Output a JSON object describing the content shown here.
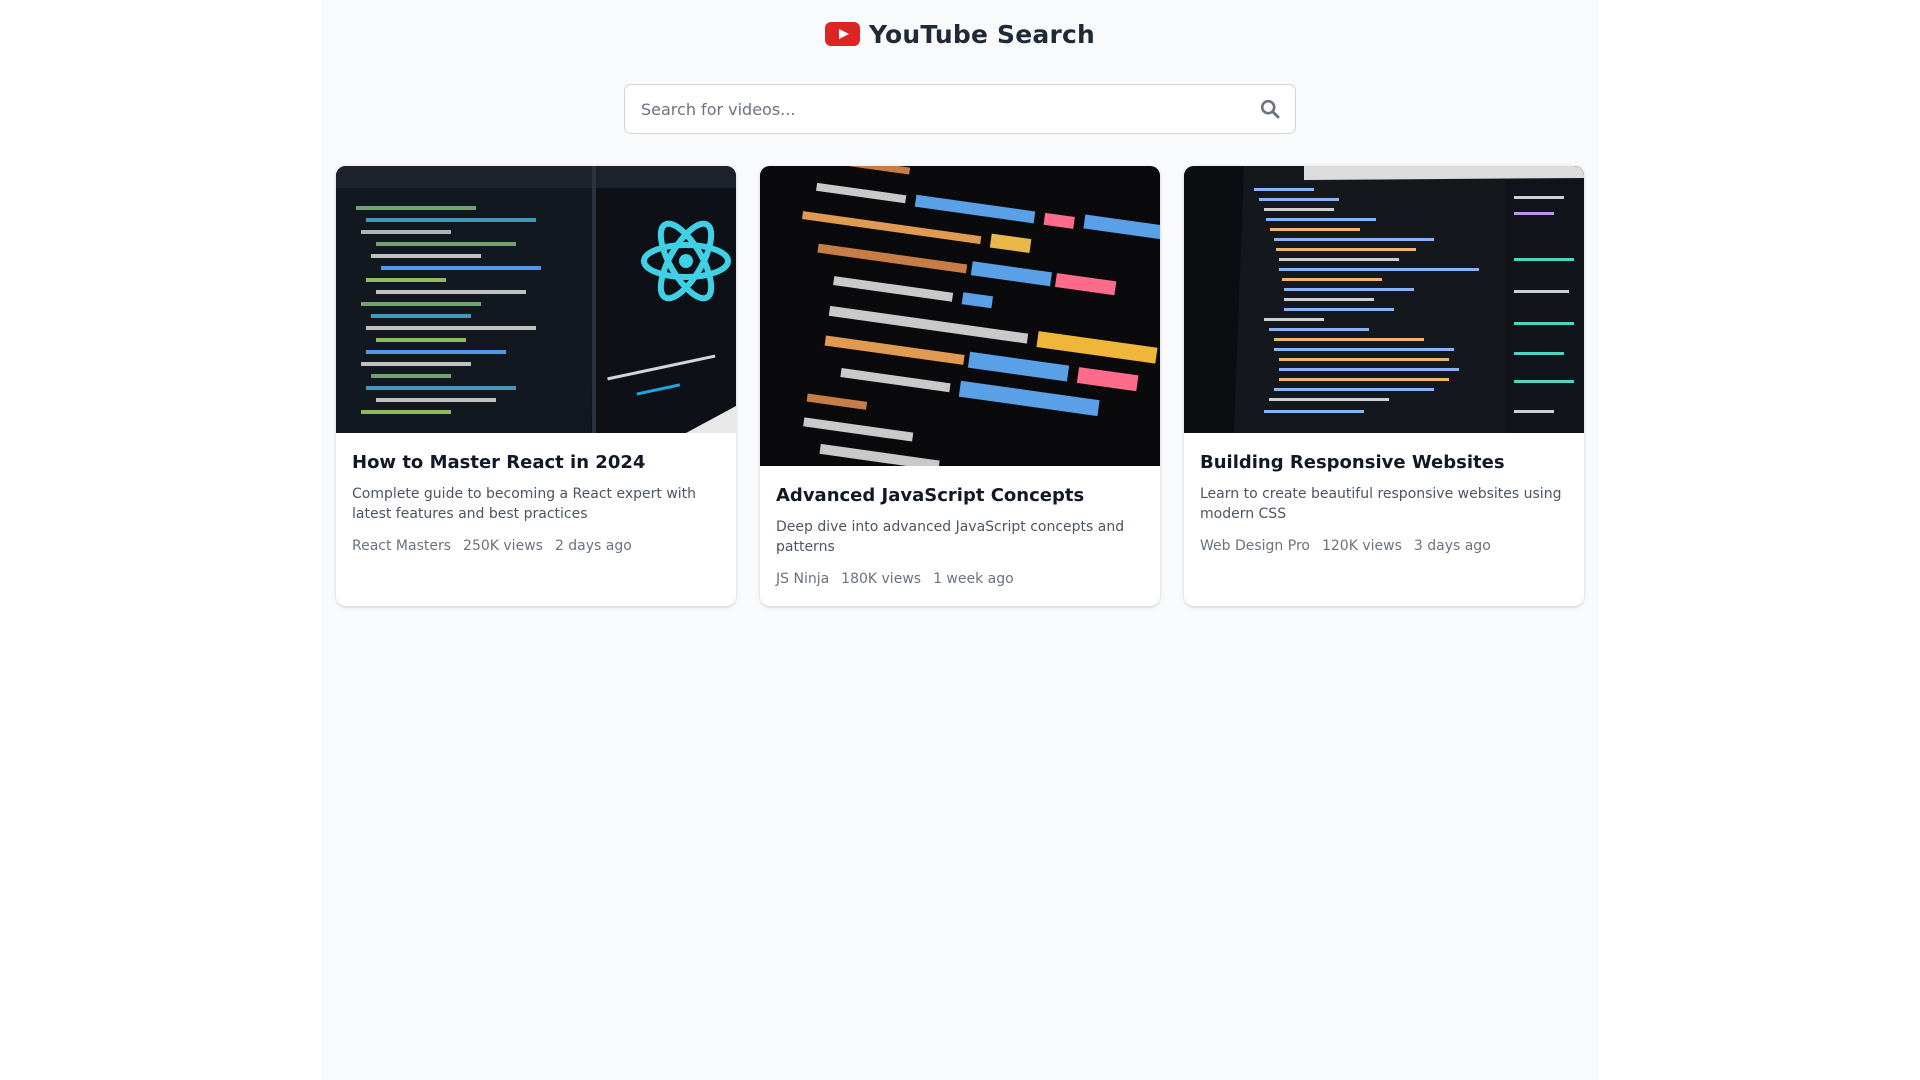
{
  "header": {
    "title": "YouTube Search",
    "logo_icon": "youtube-play-icon",
    "brand_color": "#dc2626"
  },
  "search": {
    "placeholder": "Search for videos...",
    "value": "",
    "button_icon": "search-icon"
  },
  "videos": [
    {
      "title": "How to Master React in 2024",
      "description": "Complete guide to becoming a React expert with latest features and best practices",
      "channel": "React Masters",
      "views": "250K views",
      "uploaded": "2 days ago",
      "thumbnail_icon": "react-code-thumbnail"
    },
    {
      "title": "Advanced JavaScript Concepts",
      "description": "Deep dive into advanced JavaScript concepts and patterns",
      "channel": "JS Ninja",
      "views": "180K views",
      "uploaded": "1 week ago",
      "thumbnail_icon": "javascript-code-thumbnail"
    },
    {
      "title": "Building Responsive Websites",
      "description": "Learn to create beautiful responsive websites using modern CSS",
      "channel": "Web Design Pro",
      "views": "120K views",
      "uploaded": "3 days ago",
      "thumbnail_icon": "html-devtools-thumbnail"
    }
  ]
}
